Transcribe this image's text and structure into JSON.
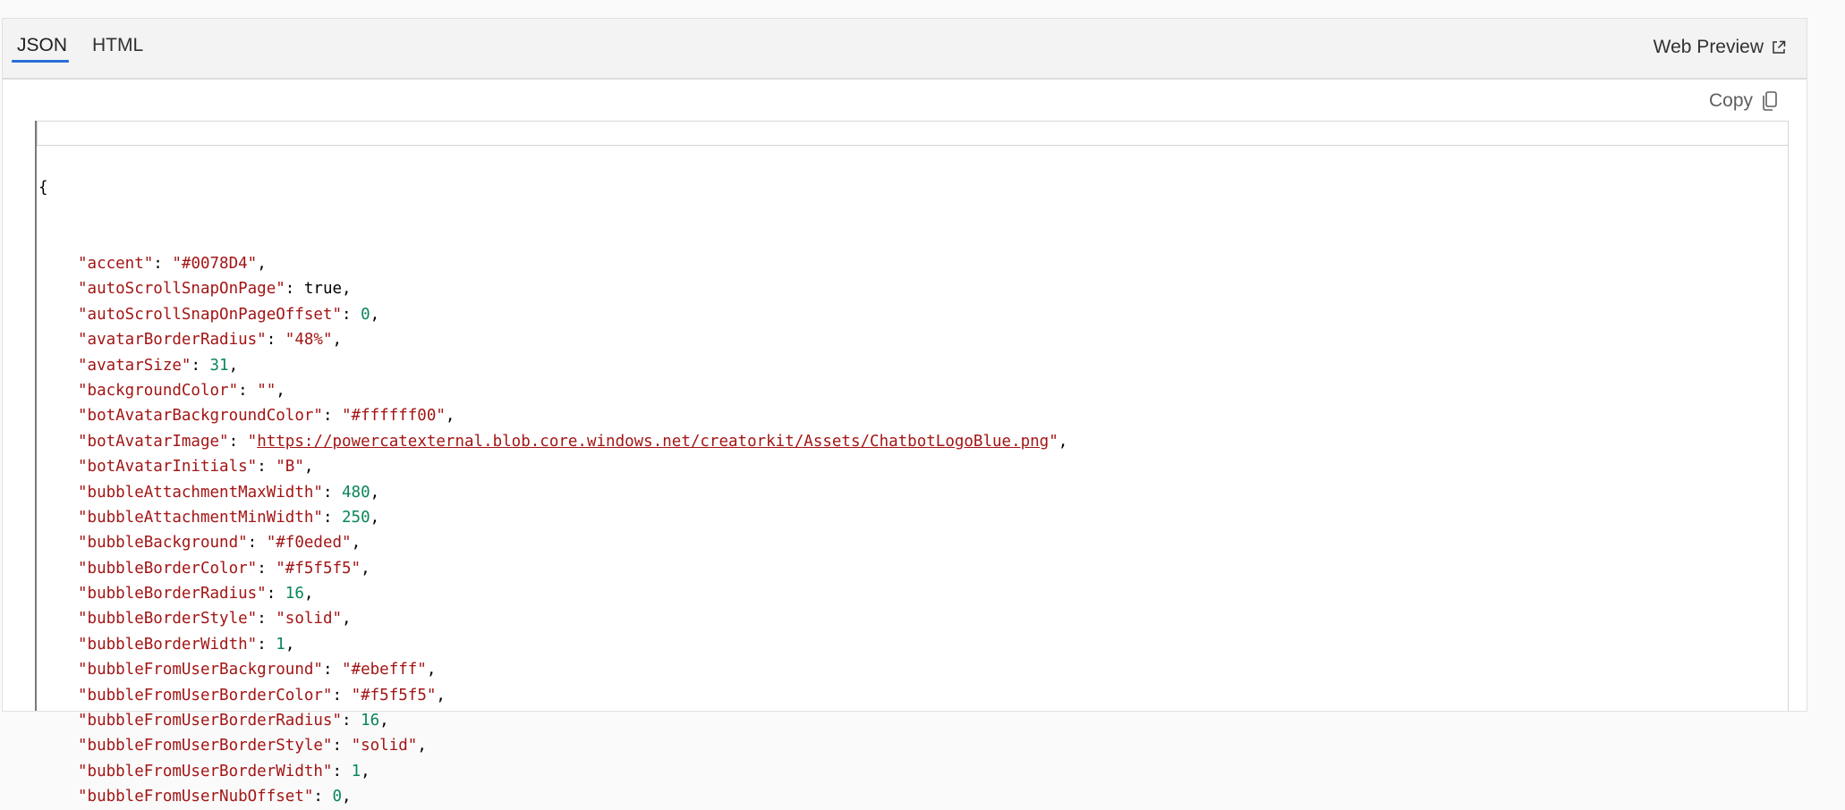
{
  "tabs": [
    {
      "label": "JSON",
      "active": true
    },
    {
      "label": "HTML",
      "active": false
    }
  ],
  "header": {
    "web_preview_label": "Web Preview",
    "web_preview_icon": "external-link-icon"
  },
  "toolbar": {
    "copy_label": "Copy",
    "copy_icon": "copy-icon"
  },
  "code": {
    "open_brace": "{",
    "lines": [
      {
        "key": "\"accent\"",
        "value": "\"#0078D4\"",
        "type": "string"
      },
      {
        "key": "\"autoScrollSnapOnPage\"",
        "value": "true",
        "type": "bool"
      },
      {
        "key": "\"autoScrollSnapOnPageOffset\"",
        "value": "0",
        "type": "number"
      },
      {
        "key": "\"avatarBorderRadius\"",
        "value": "\"48%\"",
        "type": "string"
      },
      {
        "key": "\"avatarSize\"",
        "value": "31",
        "type": "number"
      },
      {
        "key": "\"backgroundColor\"",
        "value": "\"\"",
        "type": "string"
      },
      {
        "key": "\"botAvatarBackgroundColor\"",
        "value": "\"#ffffff00\"",
        "type": "string"
      },
      {
        "key": "\"botAvatarImage\"",
        "value": "\"https://powercatexternal.blob.core.windows.net/creatorkit/Assets/ChatbotLogoBlue.png\"",
        "url": "https://powercatexternal.blob.core.windows.net/creatorkit/Assets/ChatbotLogoBlue.png",
        "type": "url"
      },
      {
        "key": "\"botAvatarInitials\"",
        "value": "\"B\"",
        "type": "string"
      },
      {
        "key": "\"bubbleAttachmentMaxWidth\"",
        "value": "480",
        "type": "number"
      },
      {
        "key": "\"bubbleAttachmentMinWidth\"",
        "value": "250",
        "type": "number"
      },
      {
        "key": "\"bubbleBackground\"",
        "value": "\"#f0eded\"",
        "type": "string"
      },
      {
        "key": "\"bubbleBorderColor\"",
        "value": "\"#f5f5f5\"",
        "type": "string"
      },
      {
        "key": "\"bubbleBorderRadius\"",
        "value": "16",
        "type": "number"
      },
      {
        "key": "\"bubbleBorderStyle\"",
        "value": "\"solid\"",
        "type": "string"
      },
      {
        "key": "\"bubbleBorderWidth\"",
        "value": "1",
        "type": "number"
      },
      {
        "key": "\"bubbleFromUserBackground\"",
        "value": "\"#ebefff\"",
        "type": "string"
      },
      {
        "key": "\"bubbleFromUserBorderColor\"",
        "value": "\"#f5f5f5\"",
        "type": "string"
      },
      {
        "key": "\"bubbleFromUserBorderRadius\"",
        "value": "16",
        "type": "number"
      },
      {
        "key": "\"bubbleFromUserBorderStyle\"",
        "value": "\"solid\"",
        "type": "string"
      },
      {
        "key": "\"bubbleFromUserBorderWidth\"",
        "value": "1",
        "type": "number"
      },
      {
        "key": "\"bubbleFromUserNubOffset\"",
        "value": "0",
        "type": "number"
      }
    ]
  },
  "colors": {
    "key": "#a31515",
    "string": "#a31515",
    "number": "#098658",
    "bool": "#000000",
    "tab_underline": "#2a6fd6"
  }
}
